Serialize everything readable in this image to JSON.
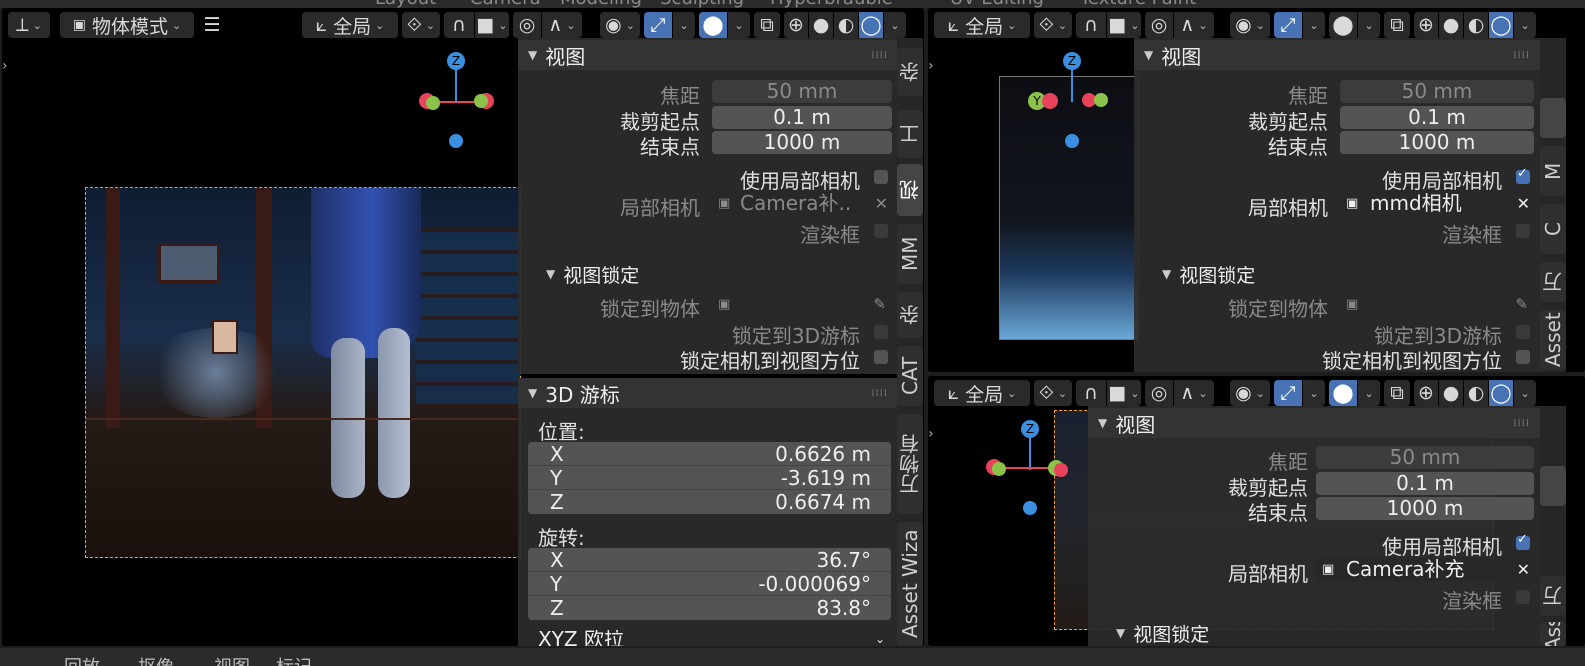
{
  "top_tabs": [
    "Layout",
    "Camera",
    "Modeling",
    "Sculpting",
    "Hyperbrauble",
    "UV Editing",
    "Texture Paint"
  ],
  "left_viewport": {
    "mode_label": "物体模式",
    "orientation_label": "全局",
    "panel_view": {
      "title": "视图",
      "focal_label": "焦距",
      "focal_value": "50 mm",
      "clip_start_label": "裁剪起点",
      "clip_start_value": "0.1 m",
      "clip_end_label": "结束点",
      "clip_end_value": "1000 m",
      "use_local_camera_label": "使用局部相机",
      "use_local_camera": false,
      "local_camera_label": "局部相机",
      "local_camera_value": "Camera补..",
      "render_border_label": "渲染框",
      "view_lock_title": "视图锁定",
      "lock_object_label": "锁定到物体",
      "lock_cursor_label": "锁定到3D游标",
      "lock_camera_label": "锁定相机到视图方位"
    },
    "panel_cursor": {
      "title": "3D 游标",
      "location_label": "位置:",
      "location": [
        {
          "axis": "X",
          "value": "0.6626 m"
        },
        {
          "axis": "Y",
          "value": "-3.619 m"
        },
        {
          "axis": "Z",
          "value": "0.6674 m"
        }
      ],
      "rotation_label": "旋转:",
      "rotation": [
        {
          "axis": "X",
          "value": "36.7°"
        },
        {
          "axis": "Y",
          "value": "-0.000069°"
        },
        {
          "axis": "Z",
          "value": "83.8°"
        }
      ],
      "rotation_mode": "XYZ 欧拉"
    },
    "side_tabs": [
      "杂",
      "工",
      "视",
      "MM",
      "杂",
      "CAT",
      "万物有",
      "Asset Wiza"
    ]
  },
  "top_right_viewport": {
    "orientation_label": "全局",
    "panel_view": {
      "title": "视图",
      "focal_label": "焦距",
      "focal_value": "50 mm",
      "clip_start_label": "裁剪起点",
      "clip_start_value": "0.1 m",
      "clip_end_label": "结束点",
      "clip_end_value": "1000 m",
      "use_local_camera_label": "使用局部相机",
      "use_local_camera": true,
      "local_camera_label": "局部相机",
      "local_camera_value": "mmd相机",
      "render_border_label": "渲染框",
      "view_lock_title": "视图锁定",
      "lock_object_label": "锁定到物体",
      "lock_cursor_label": "锁定到3D游标",
      "lock_camera_label": "锁定相机到视图方位"
    },
    "side_tabs": [
      "M",
      "C",
      "万",
      "Asset"
    ]
  },
  "bottom_right_viewport": {
    "orientation_label": "全局",
    "panel_view": {
      "title": "视图",
      "focal_label": "焦距",
      "focal_value": "50 mm",
      "clip_start_label": "裁剪起点",
      "clip_start_value": "0.1 m",
      "clip_end_label": "结束点",
      "clip_end_value": "1000 m",
      "use_local_camera_label": "使用局部相机",
      "use_local_camera": true,
      "local_camera_label": "局部相机",
      "local_camera_value": "Camera补充",
      "render_border_label": "渲染框",
      "view_lock_title": "视图锁定"
    },
    "side_tabs": [
      "万",
      "Ass"
    ]
  },
  "status_bar": [
    "回放",
    "抠像",
    "视图",
    "标记"
  ],
  "colors": {
    "accent_blue": "#4772b3",
    "gizmo_x": "#e8435a",
    "gizmo_y": "#8bc34a",
    "gizmo_z": "#3b8fe0",
    "camera_frame": "#f0a030"
  }
}
